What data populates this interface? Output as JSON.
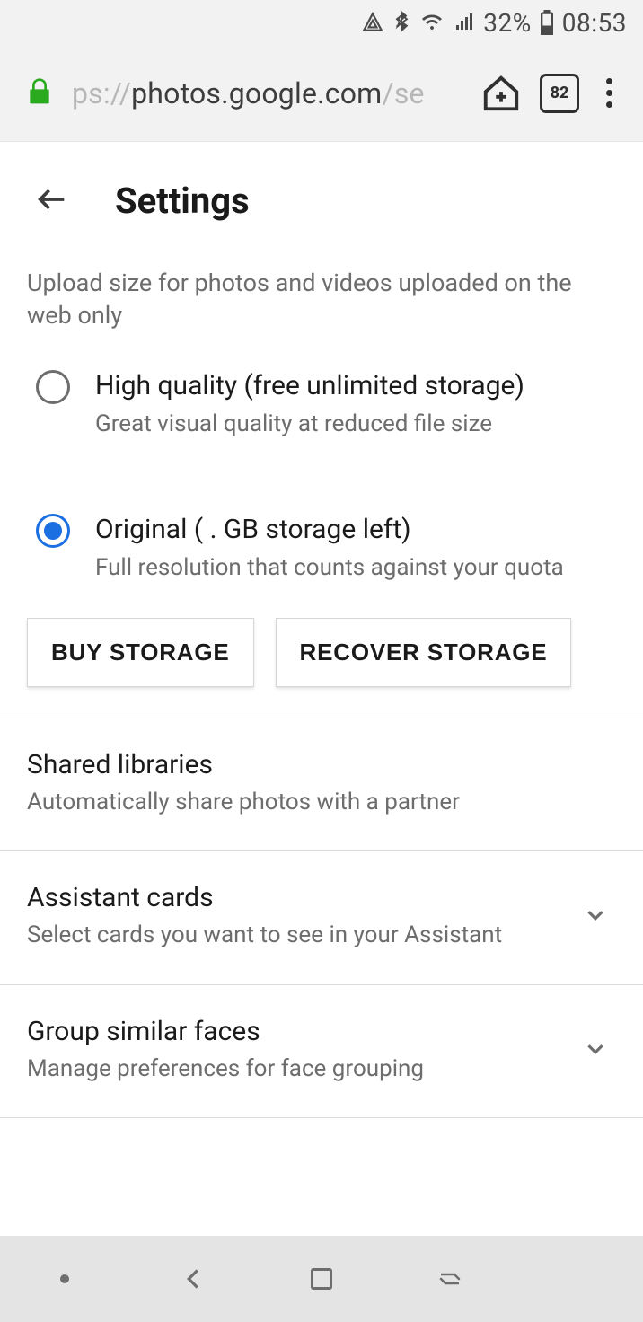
{
  "status": {
    "battery_pct": "32%",
    "time": "08:53"
  },
  "browser": {
    "url_prefix": "ps://",
    "url_host": "photos.google.com",
    "url_path": "/se",
    "tab_count": "82"
  },
  "page": {
    "title": "Settings",
    "upload_desc": "Upload size for photos and videos uploaded on the web only",
    "options": {
      "high_quality": {
        "label": "High quality (free unlimited storage)",
        "sub": "Great visual quality at reduced file size"
      },
      "original": {
        "label": "Original (    .   GB storage left)",
        "sub": "Full resolution that counts against your quota"
      }
    },
    "buttons": {
      "buy": "BUY STORAGE",
      "recover": "RECOVER STORAGE"
    },
    "rows": {
      "shared": {
        "title": "Shared libraries",
        "sub": "Automatically share photos with a partner"
      },
      "assistant": {
        "title": "Assistant cards",
        "sub": "Select cards you want to see in your Assistant"
      },
      "faces": {
        "title": "Group similar faces",
        "sub": "Manage preferences for face grouping"
      }
    }
  }
}
